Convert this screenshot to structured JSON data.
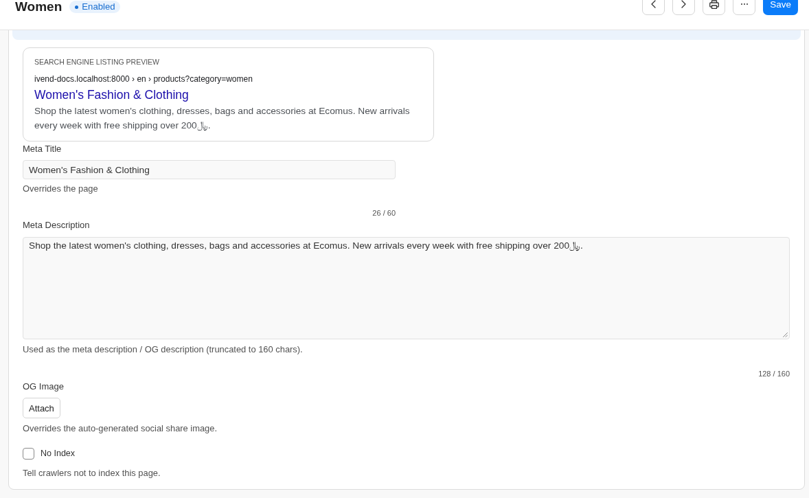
{
  "header": {
    "title": "Women",
    "status_badge": "Enabled",
    "buttons": [
      {
        "kind": "previous"
      },
      {
        "kind": "next"
      },
      {
        "kind": "print"
      },
      {
        "kind": "more"
      },
      {
        "kind": "save",
        "label": "Save"
      }
    ]
  },
  "section": {
    "preview": {
      "heading": "SEARCH ENGINE LISTING PREVIEW",
      "url": "ivend-docs.localhost:8000 › en › products?category=women",
      "title": "Women's Fashion & Clothing",
      "description": "Shop the latest women's clothing, dresses, bags and accessories at Ecomus. New arrivals every week with free shipping over 200﷼."
    },
    "fields": [
      {
        "kind": "text",
        "label": "Meta Title",
        "value": "Women's Fashion & Clothing",
        "help": "Overrides the page",
        "counter": "26 / 60"
      },
      {
        "kind": "textarea",
        "label": "Meta Description",
        "value": "Shop the latest women's clothing, dresses, bags and accessories at Ecomus. New arrivals every week with free shipping over 200﷼.",
        "help": "Used as the meta description / OG description (truncated to 160 chars).",
        "counter": "128 / 160"
      },
      {
        "kind": "attach",
        "label": "OG Image",
        "button": "Attach",
        "help": "Overrides the auto-generated social share image."
      },
      {
        "kind": "checkbox",
        "label": "No Index",
        "checked": false,
        "help": "Tell crawlers not to index this page."
      }
    ]
  }
}
